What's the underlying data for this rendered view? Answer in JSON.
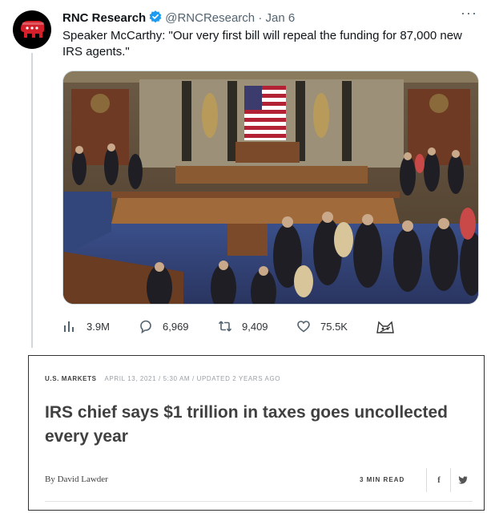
{
  "tweet": {
    "name": "RNC Research",
    "handle": "@RNCResearch",
    "separator": "·",
    "date": "Jan 6",
    "more": "···",
    "text": "Speaker McCarthy: \"Our very first bill will repeal the funding for 87,000 new IRS agents.\"",
    "stats": {
      "views": "3.9M",
      "replies": "6,969",
      "retweets": "9,409",
      "likes": "75.5K"
    },
    "avatar_icon": "gop-elephant-icon",
    "verified_color": "#1d9bf0"
  },
  "article": {
    "section": "U.S. MARKETS",
    "timestamp": "APRIL 13, 2021 / 5:30 AM / UPDATED 2 YEARS AGO",
    "headline": "IRS chief says $1 trillion in taxes goes uncollected every year",
    "byline": "By David Lawder",
    "read_time": "3 MIN READ",
    "share_facebook": "f",
    "share_twitter": "twitter-bird-icon"
  }
}
